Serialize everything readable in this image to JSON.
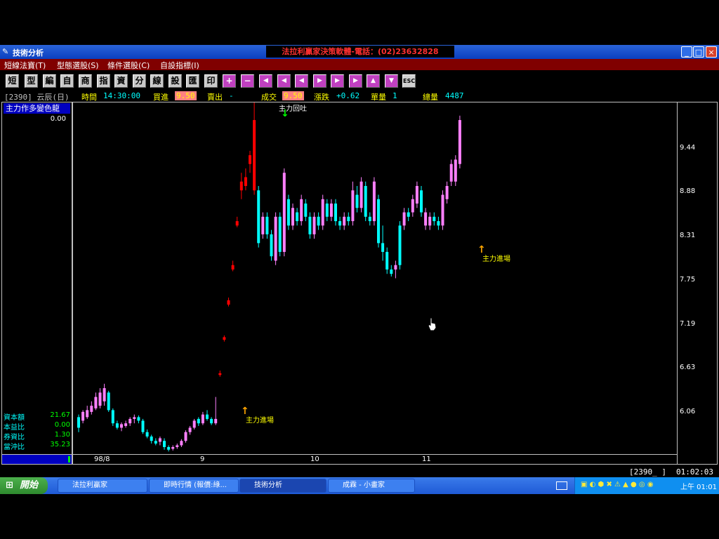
{
  "window": {
    "title": "技術分析",
    "center_banner": "法拉利贏家決策軟體-電話：(02)23632828"
  },
  "menu": [
    "短線法寶(T)",
    "型態選股(S)",
    "條件選股(C)",
    "自設指標(I)"
  ],
  "toolbar": {
    "labels": [
      "短",
      "型",
      "編",
      "自",
      "商",
      "指",
      "資",
      "分",
      "線",
      "設",
      "匯",
      "印"
    ],
    "plus": "+",
    "minus": "−",
    "nav": [
      "◀",
      "◀",
      "◀",
      "▶",
      "▶",
      "▶",
      "▲",
      "▼"
    ],
    "esc": "ESC"
  },
  "info": {
    "code": "[2390] 云辰(日)",
    "time_label": "時間",
    "time": "14:30:00",
    "buy_label": "買進",
    "buy": "9.50",
    "sell_label": "賣出",
    "sell": "-",
    "deal_label": "成交",
    "deal": "9.50",
    "change_label": "漲跌",
    "change": "+0.62",
    "vol_label": "單量",
    "vol": "1",
    "total_label": "總量",
    "total": "4487"
  },
  "left_panel": {
    "indicator": "主力作多變色龍",
    "value": "0.00",
    "stats": [
      {
        "label": "資本額",
        "value": "21.67"
      },
      {
        "label": "本益比",
        "value": "0.00"
      },
      {
        "label": "券資比",
        "value": "1.30"
      },
      {
        "label": "當沖比",
        "value": "35.23"
      }
    ]
  },
  "price_axis": [
    "9.44",
    "8.88",
    "8.31",
    "7.75",
    "7.19",
    "6.63",
    "6.06"
  ],
  "date_axis": [
    "98/8",
    "9",
    "10",
    "11"
  ],
  "annotations": {
    "exit": "主力回吐",
    "enter1": "主力進場",
    "enter2": "主力進場"
  },
  "status": {
    "code": "[2390_ ]",
    "clock": "01:02:03"
  },
  "taskbar": {
    "start": "開始",
    "tasks": [
      "法拉利贏家",
      "即時行情 (報價:綠...",
      "技術分析",
      "成霖 - 小畫家"
    ],
    "time": "上午 01:01"
  },
  "chart_data": {
    "type": "candlestick",
    "ylim": [
      5.7,
      9.7
    ],
    "colors": {
      "up": "#ff80ff",
      "down": "#00ffff",
      "limit_up": "#ff0000"
    },
    "candles": [
      [
        6.0,
        6.12,
        5.95,
        6.15,
        "d"
      ],
      [
        6.08,
        6.18,
        6.05,
        6.2,
        "u"
      ],
      [
        6.12,
        6.2,
        6.1,
        6.25,
        "u"
      ],
      [
        6.18,
        6.25,
        6.15,
        6.3,
        "u"
      ],
      [
        6.22,
        6.35,
        6.2,
        6.4,
        "u"
      ],
      [
        6.25,
        6.4,
        6.22,
        6.45,
        "u"
      ],
      [
        6.3,
        6.45,
        6.25,
        6.5,
        "u"
      ],
      [
        6.4,
        6.2,
        6.18,
        6.42,
        "d"
      ],
      [
        6.2,
        6.05,
        6.02,
        6.22,
        "d"
      ],
      [
        6.05,
        6.0,
        5.98,
        6.08,
        "d"
      ],
      [
        6.0,
        6.04,
        5.96,
        6.06,
        "u"
      ],
      [
        6.02,
        6.05,
        6.0,
        6.08,
        "u"
      ],
      [
        6.05,
        6.1,
        6.02,
        6.12,
        "u"
      ],
      [
        6.1,
        6.12,
        6.05,
        6.15,
        "u"
      ],
      [
        6.12,
        6.08,
        6.05,
        6.14,
        "d"
      ],
      [
        6.08,
        5.95,
        5.93,
        6.1,
        "d"
      ],
      [
        5.95,
        5.9,
        5.88,
        5.98,
        "d"
      ],
      [
        5.9,
        5.85,
        5.82,
        5.92,
        "d"
      ],
      [
        5.85,
        5.82,
        5.8,
        5.88,
        "d"
      ],
      [
        5.84,
        5.88,
        5.8,
        5.9,
        "u"
      ],
      [
        5.85,
        5.78,
        5.75,
        5.88,
        "d"
      ],
      [
        5.78,
        5.75,
        5.73,
        5.8,
        "d"
      ],
      [
        5.76,
        5.78,
        5.74,
        5.8,
        "u"
      ],
      [
        5.78,
        5.8,
        5.76,
        5.82,
        "u"
      ],
      [
        5.8,
        5.85,
        5.78,
        5.87,
        "u"
      ],
      [
        5.85,
        5.95,
        5.83,
        5.97,
        "u"
      ],
      [
        5.95,
        6.0,
        5.92,
        6.02,
        "u"
      ],
      [
        6.0,
        6.08,
        5.98,
        6.1,
        "u"
      ],
      [
        6.1,
        6.05,
        6.02,
        6.12,
        "d"
      ],
      [
        6.05,
        6.15,
        6.03,
        6.18,
        "u"
      ],
      [
        6.15,
        6.1,
        6.08,
        6.2,
        "d"
      ],
      [
        6.1,
        6.05,
        6.03,
        6.12,
        "d"
      ],
      [
        6.05,
        6.1,
        6.03,
        6.35,
        "u"
      ],
      [
        6.6,
        6.62,
        6.58,
        6.65,
        "l"
      ],
      [
        7.0,
        7.03,
        6.98,
        7.05,
        "l"
      ],
      [
        7.4,
        7.45,
        7.38,
        7.48,
        "l"
      ],
      [
        7.8,
        7.85,
        7.78,
        7.9,
        "l"
      ],
      [
        8.3,
        8.35,
        8.28,
        8.4,
        "l"
      ],
      [
        8.7,
        8.8,
        8.6,
        8.9,
        "l"
      ],
      [
        8.75,
        8.85,
        8.7,
        8.95,
        "l"
      ],
      [
        9.0,
        9.1,
        8.9,
        9.15,
        "l"
      ],
      [
        8.7,
        9.5,
        8.65,
        9.8,
        "l"
      ],
      [
        8.7,
        8.1,
        8.05,
        8.75,
        "d"
      ],
      [
        8.2,
        8.4,
        8.15,
        8.45,
        "u"
      ],
      [
        8.4,
        8.2,
        8.15,
        8.45,
        "d"
      ],
      [
        8.2,
        7.95,
        7.9,
        8.25,
        "d"
      ],
      [
        7.9,
        8.4,
        7.85,
        8.45,
        "u"
      ],
      [
        8.4,
        8.0,
        7.95,
        8.45,
        "d"
      ],
      [
        8.0,
        8.9,
        7.95,
        8.95,
        "u"
      ],
      [
        8.6,
        8.3,
        8.25,
        8.65,
        "d"
      ],
      [
        8.3,
        8.5,
        8.25,
        8.55,
        "u"
      ],
      [
        8.45,
        8.35,
        8.3,
        8.5,
        "d"
      ],
      [
        8.35,
        8.6,
        8.3,
        8.65,
        "u"
      ],
      [
        8.55,
        8.4,
        8.35,
        8.6,
        "d"
      ],
      [
        8.4,
        8.2,
        8.15,
        8.45,
        "d"
      ],
      [
        8.2,
        8.4,
        8.15,
        8.45,
        "u"
      ],
      [
        8.4,
        8.3,
        8.25,
        8.45,
        "d"
      ],
      [
        8.3,
        8.6,
        8.25,
        8.65,
        "u"
      ],
      [
        8.55,
        8.4,
        8.35,
        8.6,
        "d"
      ],
      [
        8.4,
        8.55,
        8.35,
        8.6,
        "u"
      ],
      [
        8.55,
        8.35,
        8.3,
        8.6,
        "d"
      ],
      [
        8.35,
        8.3,
        8.25,
        8.4,
        "d"
      ],
      [
        8.3,
        8.4,
        8.25,
        8.45,
        "u"
      ],
      [
        8.4,
        8.35,
        8.3,
        8.45,
        "d"
      ],
      [
        8.35,
        8.7,
        8.3,
        8.8,
        "u"
      ],
      [
        8.65,
        8.5,
        8.45,
        8.75,
        "d"
      ],
      [
        8.5,
        8.8,
        8.45,
        8.85,
        "u"
      ],
      [
        8.75,
        8.4,
        8.35,
        8.8,
        "d"
      ],
      [
        8.4,
        8.35,
        8.3,
        8.45,
        "d"
      ],
      [
        8.35,
        8.8,
        8.3,
        8.85,
        "u"
      ],
      [
        8.6,
        8.1,
        8.05,
        8.65,
        "d"
      ],
      [
        8.1,
        8.0,
        7.9,
        8.3,
        "d"
      ],
      [
        8.0,
        7.8,
        7.75,
        8.05,
        "d"
      ],
      [
        7.8,
        7.75,
        7.72,
        7.85,
        "d"
      ],
      [
        7.8,
        7.85,
        7.7,
        7.9,
        "u"
      ],
      [
        7.85,
        8.3,
        7.8,
        8.35,
        "d"
      ],
      [
        8.3,
        8.45,
        8.25,
        8.5,
        "u"
      ],
      [
        8.4,
        8.45,
        8.35,
        8.5,
        "d"
      ],
      [
        8.45,
        8.6,
        8.4,
        8.65,
        "u"
      ],
      [
        8.55,
        8.75,
        8.5,
        8.8,
        "u"
      ],
      [
        8.7,
        8.45,
        8.4,
        8.75,
        "d"
      ],
      [
        8.45,
        8.3,
        8.25,
        8.5,
        "u"
      ],
      [
        8.3,
        8.4,
        8.25,
        8.45,
        "u"
      ],
      [
        8.4,
        8.35,
        8.3,
        8.45,
        "d"
      ],
      [
        8.35,
        8.3,
        8.25,
        8.4,
        "d"
      ],
      [
        8.3,
        8.65,
        8.25,
        8.7,
        "u"
      ],
      [
        8.6,
        8.75,
        8.55,
        8.8,
        "u"
      ],
      [
        8.8,
        9.0,
        8.75,
        9.05,
        "u"
      ],
      [
        8.8,
        9.05,
        8.75,
        9.1,
        "u"
      ],
      [
        9.0,
        9.5,
        8.95,
        9.55,
        "u"
      ]
    ]
  }
}
